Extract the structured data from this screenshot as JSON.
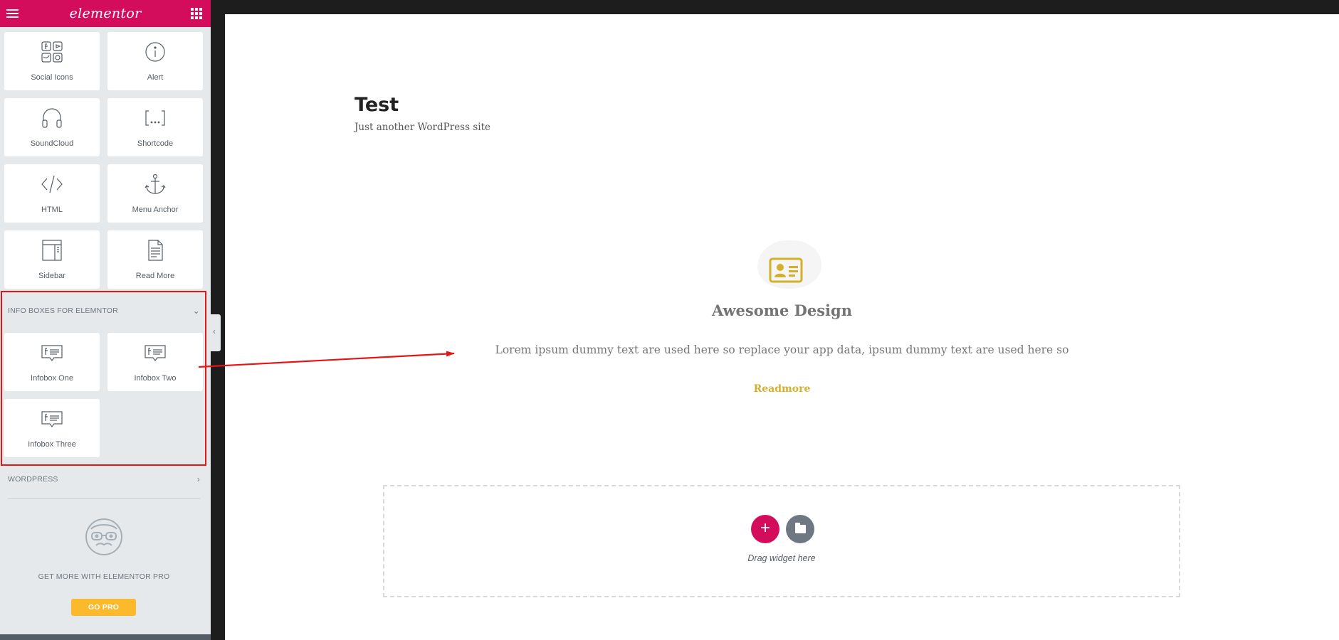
{
  "editor": {
    "brand": "elementor",
    "accent_color": "#d30c5c",
    "menu_icon": "hamburger-icon",
    "grid_icon": "apps-grid-icon"
  },
  "widgets_top": [
    {
      "label": "Social Icons",
      "icon": "social-icons-icon"
    },
    {
      "label": "Alert",
      "icon": "info-circle-icon"
    },
    {
      "label": "SoundCloud",
      "icon": "headphones-icon"
    },
    {
      "label": "Shortcode",
      "icon": "shortcode-brackets-icon"
    },
    {
      "label": "HTML",
      "icon": "code-icon"
    },
    {
      "label": "Menu Anchor",
      "icon": "anchor-icon"
    },
    {
      "label": "Sidebar",
      "icon": "sidebar-layout-icon"
    },
    {
      "label": "Read More",
      "icon": "document-icon"
    }
  ],
  "category_infobox": {
    "title": "INFO BOXES FOR ELEMNTOR",
    "expanded": true,
    "widgets": [
      {
        "label": "Infobox One",
        "icon": "infobox-icon"
      },
      {
        "label": "Infobox Two",
        "icon": "infobox-icon"
      },
      {
        "label": "Infobox Three",
        "icon": "infobox-icon"
      }
    ]
  },
  "category_wordpress": {
    "title": "WORDPRESS",
    "expanded": false
  },
  "pro_promo": {
    "icon": "nerd-face-icon",
    "text": "GET MORE WITH ELEMENTOR PRO",
    "button": "GO PRO",
    "button_color": "#fcb92c"
  },
  "site": {
    "title": "Test",
    "tagline": "Just another WordPress site"
  },
  "infobox": {
    "icon": "id-card-icon",
    "icon_color": "#d4af2b",
    "title": "Awesome Design",
    "text": "Lorem ipsum dummy text are used here so replace your app data, ipsum dummy text are used here so",
    "link": "Readmore"
  },
  "drop_zone": {
    "add_button": "+",
    "add_icon": "plus-icon",
    "template_icon": "folder-icon",
    "text": "Drag widget here"
  },
  "annotation": {
    "color": "#e41717"
  }
}
